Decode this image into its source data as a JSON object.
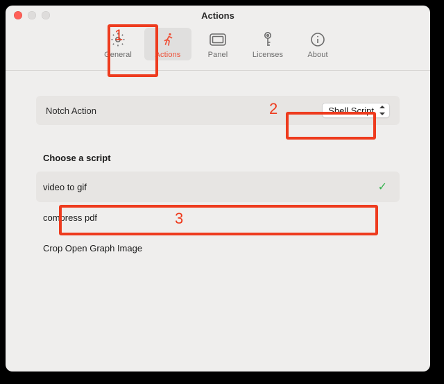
{
  "window": {
    "title": "Actions"
  },
  "toolbar": {
    "items": [
      {
        "label": "General"
      },
      {
        "label": "Actions"
      },
      {
        "label": "Panel"
      },
      {
        "label": "Licenses"
      },
      {
        "label": "About"
      }
    ]
  },
  "notch": {
    "label": "Notch Action",
    "dropdown_value": "Shell Script"
  },
  "scripts": {
    "heading": "Choose a script",
    "items": [
      {
        "label": "video to gif",
        "selected": true
      },
      {
        "label": "compress pdf",
        "selected": false
      },
      {
        "label": "Crop Open Graph Image",
        "selected": false
      }
    ]
  },
  "annotations": {
    "n1": "1",
    "n2": "2",
    "n3": "3"
  },
  "colors": {
    "accent": "#ee5037",
    "annotation": "#ee3b1e",
    "check": "#33b24c"
  }
}
